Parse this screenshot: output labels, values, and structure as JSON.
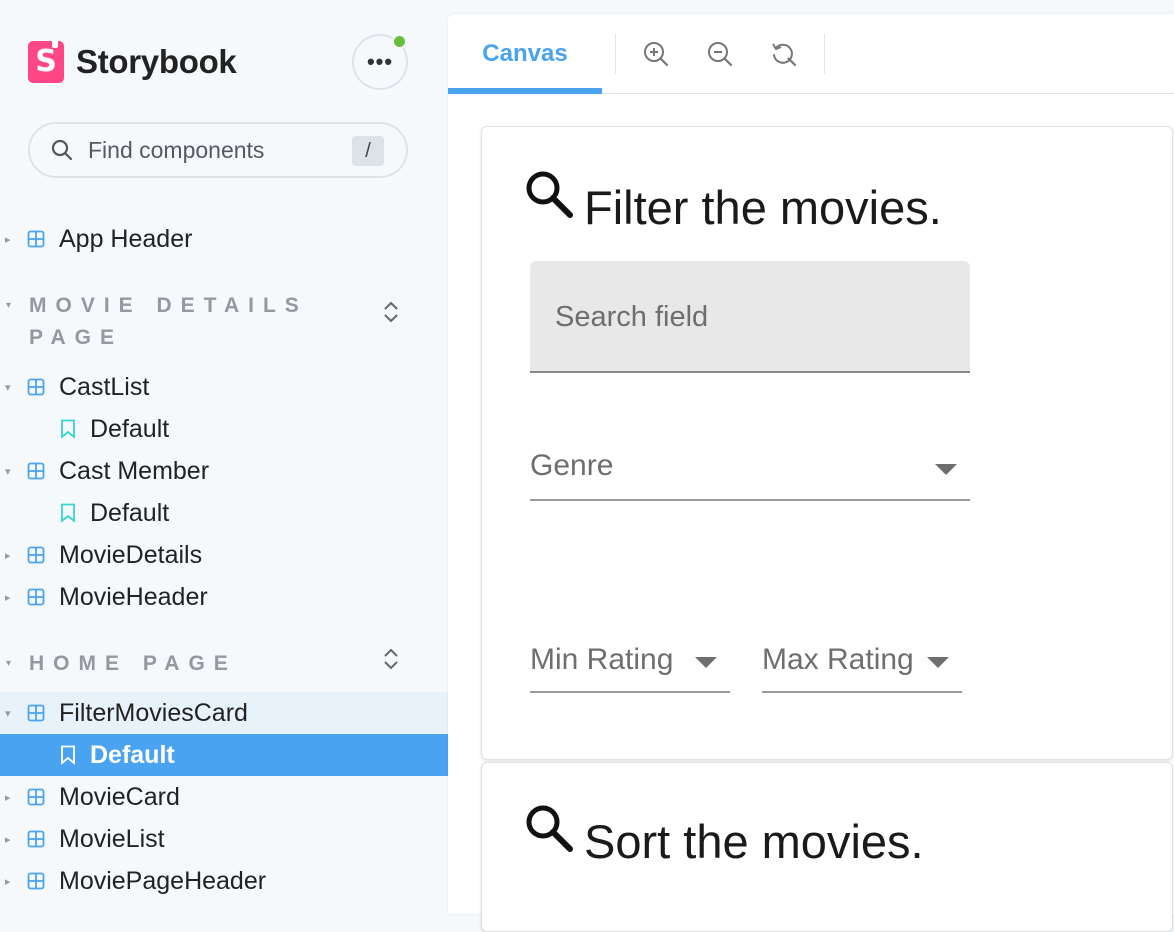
{
  "brand": {
    "name": "Storybook",
    "logo_letter": "S",
    "accent": "#ff4785"
  },
  "search": {
    "placeholder": "Find components",
    "shortcut": "/"
  },
  "sidebar": {
    "top_items": [
      {
        "label": "App Header"
      }
    ],
    "sections": [
      {
        "title": "MOVIE DETAILS PAGE",
        "items": [
          {
            "label": "CastList",
            "stories": [
              "Default"
            ]
          },
          {
            "label": "Cast Member",
            "stories": [
              "Default"
            ]
          },
          {
            "label": "MovieDetails"
          },
          {
            "label": "MovieHeader"
          }
        ]
      },
      {
        "title": "HOME PAGE",
        "items": [
          {
            "label": "FilterMoviesCard",
            "stories": [
              "Default"
            ]
          },
          {
            "label": "MovieCard"
          },
          {
            "label": "MovieList"
          },
          {
            "label": "MoviePageHeader"
          }
        ]
      }
    ],
    "selected_story": "Default",
    "selected_color": "#4aa3f1"
  },
  "toolbar": {
    "tab_label": "Canvas",
    "icons": [
      "zoom-in-icon",
      "zoom-out-icon",
      "reset-zoom-icon"
    ]
  },
  "canvas": {
    "filter_card": {
      "title": "Filter the movies.",
      "search_field_label": "Search field",
      "genre_label": "Genre",
      "min_rating_label": "Min Rating",
      "max_rating_label": "Max Rating"
    },
    "sort_card": {
      "title": "Sort the movies."
    }
  },
  "colors": {
    "sidebar_bg": "#f6f9fc",
    "tab_active": "#4aa3f1",
    "status_dot": "#66bf3c"
  }
}
